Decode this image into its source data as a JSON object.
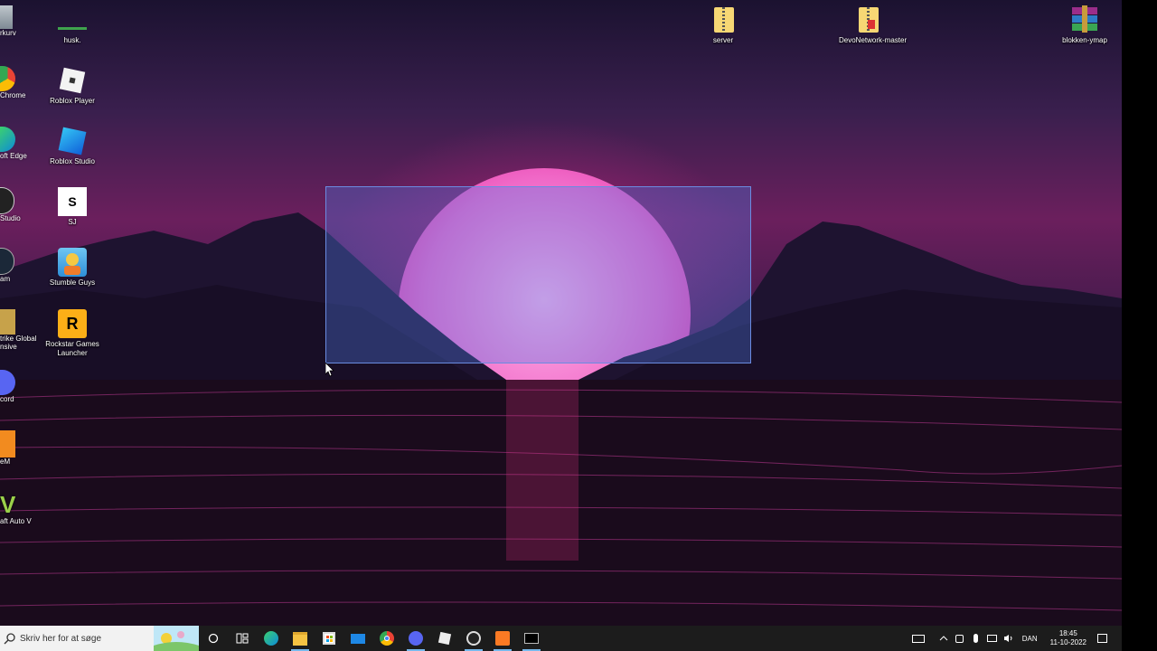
{
  "desktop": {
    "icons": [
      {
        "label": "husk."
      },
      {
        "label": "Roblox Player"
      },
      {
        "label": "Roblox Studio"
      },
      {
        "label": "SJ"
      },
      {
        "label": "Stumble Guys"
      },
      {
        "label": "Rockstar Games Launcher"
      },
      {
        "label": "server"
      },
      {
        "label": "DevoNetwork-master"
      },
      {
        "label": "blokken-ymap"
      }
    ],
    "partial_icons": [
      {
        "label": "rkurv"
      },
      {
        "label": "Chrome"
      },
      {
        "label": "oft Edge"
      },
      {
        "label": "Studio"
      },
      {
        "label": "am"
      },
      {
        "label": "trike Global"
      },
      {
        "label": "nsive"
      },
      {
        "label": "cord"
      },
      {
        "label": "eM"
      },
      {
        "label": "aft Auto V"
      }
    ]
  },
  "taskbar": {
    "search_placeholder": "Skriv her for at søge",
    "apps": [
      "search-circle",
      "task-view",
      "edge",
      "file-explorer",
      "store",
      "mail",
      "chrome",
      "discord",
      "roblox",
      "obs",
      "xampp",
      "terminal"
    ],
    "tray": {
      "language": "DAN",
      "time": "18:45",
      "date": "11-10-2022"
    }
  }
}
